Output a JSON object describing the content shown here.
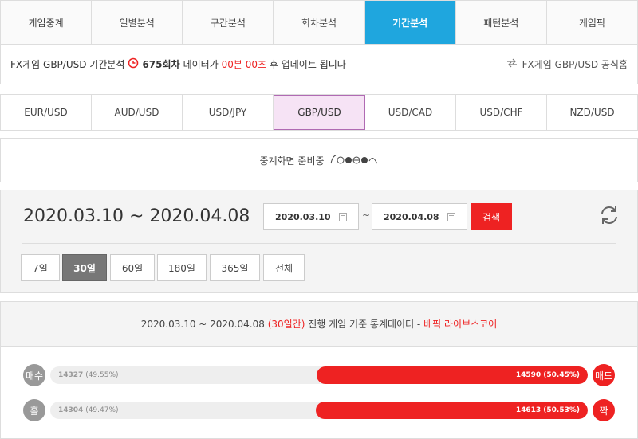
{
  "tabs": [
    {
      "label": "게임중계"
    },
    {
      "label": "일별분석"
    },
    {
      "label": "구간분석"
    },
    {
      "label": "회차분석"
    },
    {
      "label": "기간분석"
    },
    {
      "label": "패턴분석"
    },
    {
      "label": "게임픽"
    }
  ],
  "info": {
    "prefix": "FX게임 GBP/USD 기간분석",
    "round": "675회차",
    "middle": "데이터가",
    "time": "00분 00초",
    "suffix": "후 업데이트 됩니다",
    "official_link": "FX게임 GBP/USD 공식홈"
  },
  "pairs": [
    {
      "label": "EUR/USD"
    },
    {
      "label": "AUD/USD"
    },
    {
      "label": "USD/JPY"
    },
    {
      "label": "GBP/USD"
    },
    {
      "label": "USD/CAD"
    },
    {
      "label": "USD/CHF"
    },
    {
      "label": "NZD/USD"
    }
  ],
  "relay": {
    "text": "중계화면 준비중",
    "icon": "loading-emoticons"
  },
  "search": {
    "range_title": "2020.03.10 ~ 2020.04.08",
    "start_date": "2020.03.10",
    "end_date": "2020.04.08",
    "tilde": "~",
    "button": "검색",
    "periods": [
      "7일",
      "30일",
      "60일",
      "180일",
      "365일",
      "전체"
    ]
  },
  "stats": {
    "range": "2020.03.10 ~ 2020.04.08",
    "days": "(30일간)",
    "desc": "진행 게임 기준 통계데이터 -",
    "brand": "베픽 라이브스코어",
    "rows": [
      {
        "left_badge": "매수",
        "left_value": "14327",
        "left_pct": "(49.55%)",
        "right_value": "14590",
        "right_pct": "(50.45%)",
        "right_badge": "매도",
        "right_share": 0.5045
      },
      {
        "left_badge": "홀",
        "left_value": "14304",
        "left_pct": "(49.47%)",
        "right_value": "14613",
        "right_pct": "(50.53%)",
        "right_badge": "짝",
        "right_share": 0.5053
      }
    ]
  },
  "colors": {
    "active_tab": "#1fa6de",
    "accent_red": "#ee2222",
    "active_pair": "#f6e3f5"
  }
}
